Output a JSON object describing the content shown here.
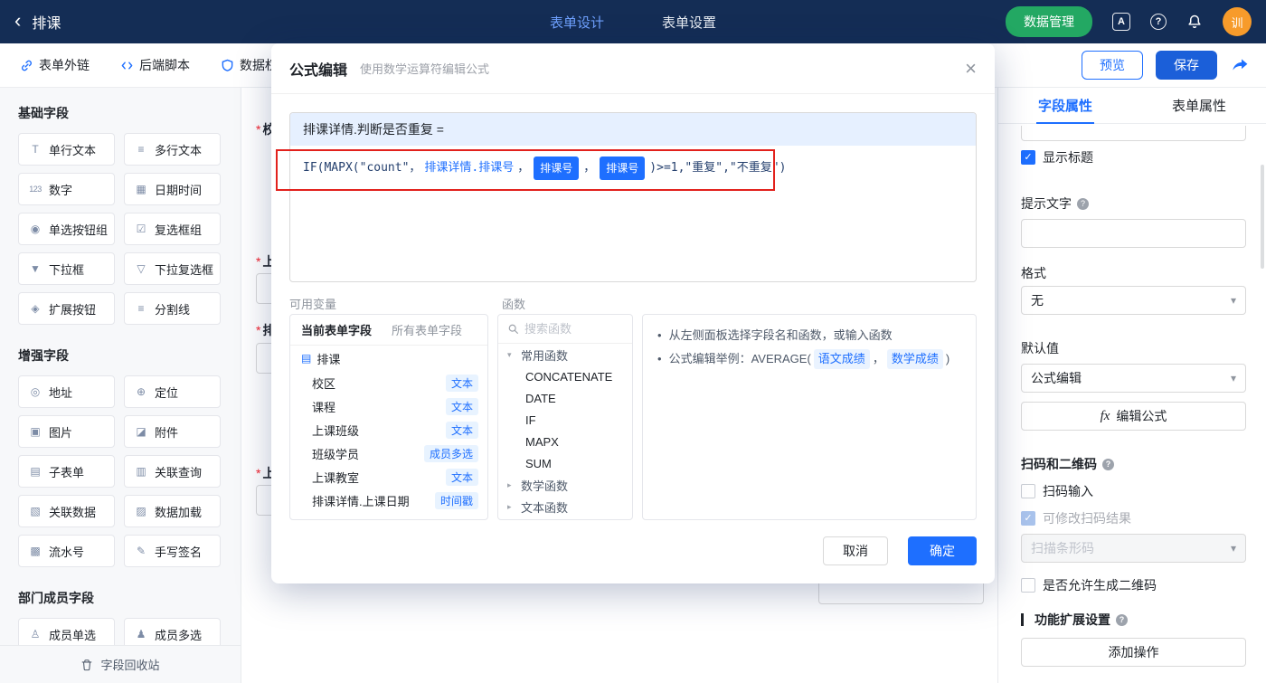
{
  "colors": {
    "topbar_bg": "#142D55",
    "accent_blue": "#1E6FFF",
    "save_blue": "#1B5FD9",
    "green_button": "#23A863",
    "avatar_orange": "#F79B2B",
    "annotation_red": "#E2211C",
    "tag_bg": "#E8F3FF",
    "formula_header_bg": "#E6F0FF"
  },
  "icons": {
    "back": "‹",
    "close": "×",
    "check": "✓",
    "question": "?",
    "chevron_down": "▾",
    "tree_expanded": "▾",
    "tree_collapsed": "▸",
    "bullet": "•",
    "doc": "▤",
    "translate": "A",
    "fx": "fx"
  },
  "topbar": {
    "title": "排课",
    "nav": [
      {
        "label": "表单设计"
      },
      {
        "label": "表单设置"
      }
    ],
    "data_manage": "数据管理",
    "avatar": "训"
  },
  "toolbar": {
    "form_link": "表单外链",
    "backend_script": "后端脚本",
    "data_permission": "数据权",
    "preview": "预览",
    "save": "保存"
  },
  "sidebar": {
    "sections": [
      {
        "title": "基础字段",
        "fields": [
          {
            "icon": "T",
            "label": "单行文本"
          },
          {
            "icon": "≡",
            "label": "多行文本"
          },
          {
            "icon": "123",
            "label": "数字"
          },
          {
            "icon": "▦",
            "label": "日期时间"
          },
          {
            "icon": "◉",
            "label": "单选按钮组"
          },
          {
            "icon": "☑",
            "label": "复选框组"
          },
          {
            "icon": "▼",
            "label": "下拉框"
          },
          {
            "icon": "▽",
            "label": "下拉复选框"
          },
          {
            "icon": "◈",
            "label": "扩展按钮"
          },
          {
            "icon": "≡",
            "label": "分割线"
          }
        ]
      },
      {
        "title": "增强字段",
        "fields": [
          {
            "icon": "◎",
            "label": "地址"
          },
          {
            "icon": "⊕",
            "label": "定位"
          },
          {
            "icon": "▣",
            "label": "图片"
          },
          {
            "icon": "◪",
            "label": "附件"
          },
          {
            "icon": "▤",
            "label": "子表单"
          },
          {
            "icon": "▥",
            "label": "关联查询"
          },
          {
            "icon": "▧",
            "label": "关联数据"
          },
          {
            "icon": "▨",
            "label": "数据加载"
          },
          {
            "icon": "▩",
            "label": "流水号"
          },
          {
            "icon": "✎",
            "label": "手写签名"
          }
        ]
      },
      {
        "title": "部门成员字段",
        "fields": [
          {
            "icon": "♙",
            "label": "成员单选"
          },
          {
            "icon": "♟",
            "label": "成员多选"
          }
        ]
      }
    ],
    "recycle": "字段回收站"
  },
  "canvas": {
    "required_mark": "*",
    "partial_labels": [
      "校",
      "上",
      "排",
      "上"
    ]
  },
  "modal": {
    "title": "公式编辑",
    "subtitle": "使用数学运算符编辑公式",
    "target_field": "排课详情.判断是否重复 =",
    "formula": {
      "part1": "IF(MAPX(\"count\"，",
      "field_ref": "排课详情.排课号",
      "comma1": "，",
      "chip1": "排课号",
      "comma2": "，",
      "chip2": "排课号",
      "part2": ")>=1,\"重复\",\"不重复\")"
    },
    "variables": {
      "label": "可用变量",
      "tab_current": "当前表单字段",
      "tab_all": "所有表单字段",
      "root": "排课",
      "items": [
        {
          "name": "校区",
          "type": "文本"
        },
        {
          "name": "课程",
          "type": "文本"
        },
        {
          "name": "上课班级",
          "type": "文本"
        },
        {
          "name": "班级学员",
          "type": "成员多选"
        },
        {
          "name": "上课教室",
          "type": "文本"
        },
        {
          "name": "排课详情.上课日期",
          "type": "时间戳"
        }
      ]
    },
    "functions": {
      "label": "函数",
      "search_placeholder": "搜索函数",
      "group_common": "常用函数",
      "common_items": [
        "CONCATENATE",
        "DATE",
        "IF",
        "MAPX",
        "SUM"
      ],
      "group_math": "数学函数",
      "group_text": "文本函数"
    },
    "help": {
      "tip1": "从左侧面板选择字段名和函数，或输入函数",
      "tip2_prefix": "公式编辑举例：AVERAGE(",
      "tip2_field1": "语文成绩",
      "tip2_comma": "，",
      "tip2_field2": "数学成绩",
      "tip2_suffix": ")"
    },
    "cancel": "取消",
    "confirm": "确定"
  },
  "properties": {
    "tab_field": "字段属性",
    "tab_form": "表单属性",
    "show_title": "显示标题",
    "hint_text": "提示文字",
    "format_label": "格式",
    "format_value": "无",
    "default_label": "默认值",
    "default_value": "公式编辑",
    "edit_formula": "编辑公式",
    "scan_section": "扫码和二维码",
    "scan_input": "扫码输入",
    "modify_scan_result": "可修改扫码结果",
    "scan_mode": "扫描条形码",
    "allow_qrcode": "是否允许生成二维码",
    "extension_section": "功能扩展设置",
    "add_action": "添加操作"
  }
}
